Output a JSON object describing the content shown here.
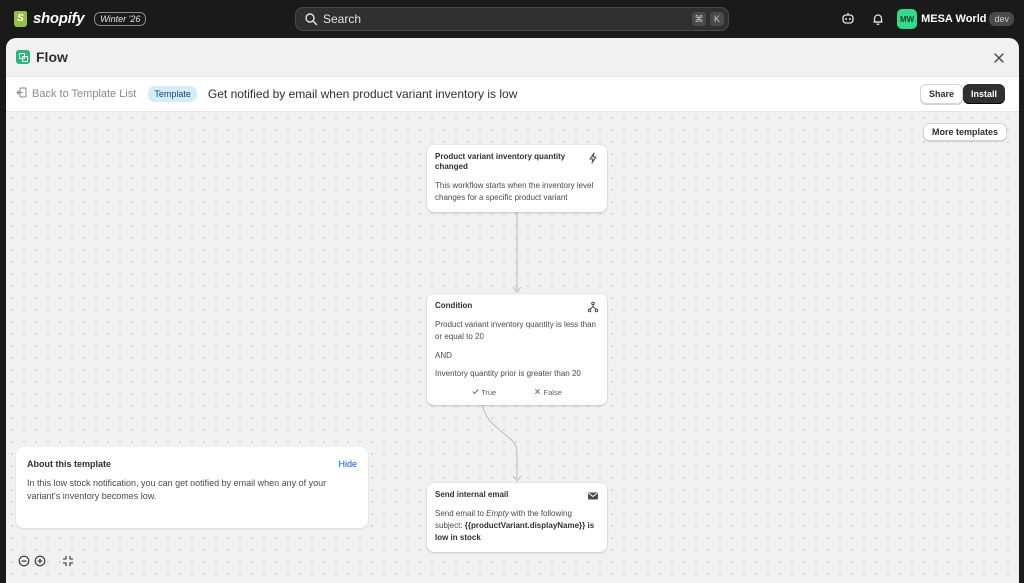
{
  "topbar": {
    "logo_text": "shopify",
    "release_badge": "Winter '26",
    "search_placeholder": "Search",
    "shortcut_keys": [
      "⌘",
      "K"
    ],
    "avatar_initials": "MW",
    "store_name": "MESA World",
    "store_badge": "dev",
    "icons": [
      "search-icon",
      "assistant-icon",
      "bell-icon"
    ]
  },
  "panel": {
    "title": "Flow",
    "close_label": "×"
  },
  "subheader": {
    "back_label": "Back to Template List",
    "badge": "Template",
    "flow_name": "Get notified by email when product variant inventory is low",
    "share_label": "Share",
    "install_label": "Install"
  },
  "canvas": {
    "more_templates_label": "More templates",
    "nodes": {
      "trigger": {
        "title": "Product variant inventory quantity changed",
        "body": "This workflow starts when the inventory level changes for a specific product variant",
        "icon": "lightning-icon"
      },
      "condition": {
        "title": "Condition",
        "line1": "Product variant inventory quantity is less than or equal to 20",
        "and_label": "AND",
        "line2": "Inventory quantity prior is greater than 20",
        "true_label": "True",
        "false_label": "False",
        "icon": "branch-icon"
      },
      "action": {
        "title": "Send internal email",
        "body_prefix": "Send email to ",
        "body_empty": "Empty",
        "body_middle": " with the following subject: ",
        "body_subject": "{{productVariant.displayName}} is low in stock",
        "icon": "envelope-icon"
      }
    },
    "about": {
      "title": "About this template",
      "hide_label": "Hide",
      "text": "In this low stock notification, you can get notified by email when any of your variant's inventory becomes low."
    },
    "zoom": {
      "icons": [
        "zoom-out-icon",
        "zoom-in-icon",
        "fit-view-icon"
      ]
    }
  }
}
